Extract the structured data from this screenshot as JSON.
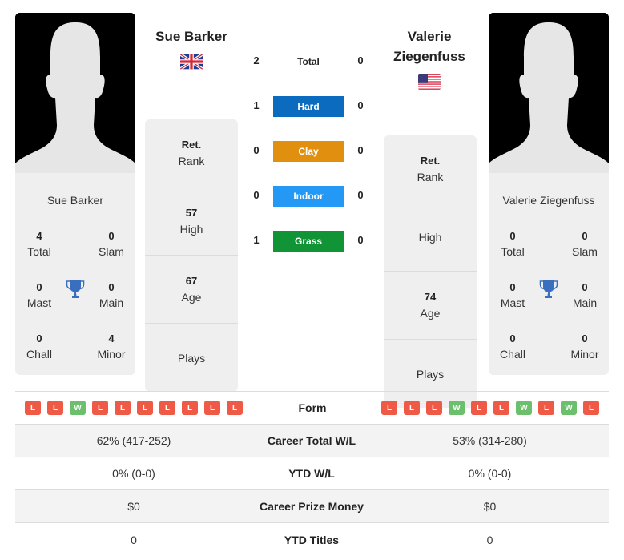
{
  "player1": {
    "name": "Sue Barker",
    "header_name": "Sue Barker",
    "flag": "uk-flag",
    "titles": {
      "total": {
        "value": "4",
        "label": "Total"
      },
      "slam": {
        "value": "0",
        "label": "Slam"
      },
      "mast": {
        "value": "0",
        "label": "Mast"
      },
      "main": {
        "value": "0",
        "label": "Main"
      },
      "chall": {
        "value": "0",
        "label": "Chall"
      },
      "minor": {
        "value": "4",
        "label": "Minor"
      }
    },
    "info": {
      "rank": {
        "value": "Ret.",
        "label": "Rank"
      },
      "high": {
        "value": "57",
        "label": "High"
      },
      "age": {
        "value": "67",
        "label": "Age"
      },
      "plays": {
        "value": "",
        "label": "Plays"
      }
    },
    "form": [
      "L",
      "L",
      "W",
      "L",
      "L",
      "L",
      "L",
      "L",
      "L",
      "L"
    ],
    "career_total_wl": "62% (417-252)",
    "ytd_wl": "0% (0-0)",
    "career_prize_money": "$0",
    "ytd_titles": "0"
  },
  "player2": {
    "name": "Valerie Ziegenfuss",
    "header_name_line1": "Valerie",
    "header_name_line2": "Ziegenfuss",
    "flag": "us-flag",
    "titles": {
      "total": {
        "value": "0",
        "label": "Total"
      },
      "slam": {
        "value": "0",
        "label": "Slam"
      },
      "mast": {
        "value": "0",
        "label": "Mast"
      },
      "main": {
        "value": "0",
        "label": "Main"
      },
      "chall": {
        "value": "0",
        "label": "Chall"
      },
      "minor": {
        "value": "0",
        "label": "Minor"
      }
    },
    "info": {
      "rank": {
        "value": "Ret.",
        "label": "Rank"
      },
      "high": {
        "value": "",
        "label": "High"
      },
      "age": {
        "value": "74",
        "label": "Age"
      },
      "plays": {
        "value": "",
        "label": "Plays"
      }
    },
    "form": [
      "L",
      "L",
      "L",
      "W",
      "L",
      "L",
      "W",
      "L",
      "W",
      "L"
    ],
    "career_total_wl": "53% (314-280)",
    "ytd_wl": "0% (0-0)",
    "career_prize_money": "$0",
    "ytd_titles": "0"
  },
  "h2h": [
    {
      "label": "Total",
      "p1": "2",
      "p2": "0",
      "color": ""
    },
    {
      "label": "Hard",
      "p1": "1",
      "p2": "0",
      "color": "#0b6cbf"
    },
    {
      "label": "Clay",
      "p1": "0",
      "p2": "0",
      "color": "#e0900e"
    },
    {
      "label": "Indoor",
      "p1": "0",
      "p2": "0",
      "color": "#2399f5"
    },
    {
      "label": "Grass",
      "p1": "1",
      "p2": "0",
      "color": "#109436"
    }
  ],
  "form_label": "Form",
  "stats_labels": {
    "career_total_wl": "Career Total W/L",
    "ytd_wl": "YTD W/L",
    "career_prize_money": "Career Prize Money",
    "ytd_titles": "YTD Titles"
  },
  "colors": {
    "win": "#6cbf6c",
    "loss": "#ee5a45",
    "trophy": "#3a6fc0"
  }
}
